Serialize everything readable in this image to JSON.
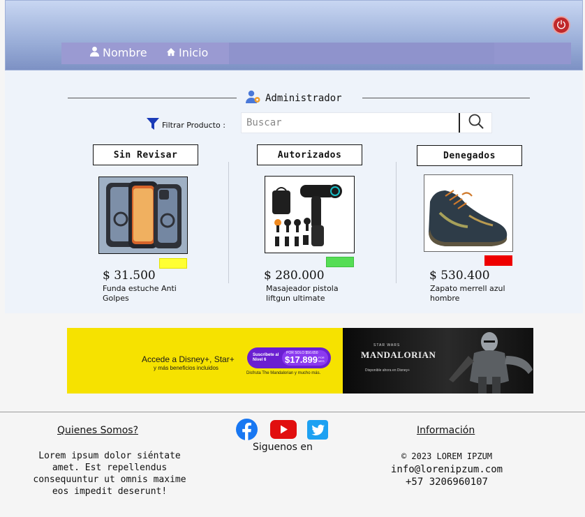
{
  "header": {
    "nav": [
      {
        "label": "Nombre",
        "icon": "user-icon"
      },
      {
        "label": "Inicio",
        "icon": "home-icon"
      }
    ],
    "power_icon": "power-icon"
  },
  "main": {
    "title": "Administrador",
    "filter_label": "Filtrar Producto :",
    "search_placeholder": "Buscar",
    "columns": [
      {
        "title": "Sin Revisar",
        "product": {
          "price": "$ 31.500",
          "name": "Funda estuche Anti Golpes",
          "status_color": "#ffff33"
        }
      },
      {
        "title": "Autorizados",
        "product": {
          "price": "$ 280.000",
          "name": "Masajeador pistola liftgun ultimate",
          "status_color": "#55dd55"
        }
      },
      {
        "title": "Denegados",
        "product": {
          "price": "$ 530.400",
          "name": "Zapato merrell azul hombre",
          "status_color": "#ee0000"
        }
      }
    ]
  },
  "banner": {
    "headline": "Accede a Disney+, Star+",
    "subline": "y más beneficios incluidos",
    "promo_top": "Suscríbete al Nivel 6",
    "promo_old": "POR SOLO $50.650",
    "promo_price": "$17.899",
    "promo_unit": "POR MES",
    "tagline": "Disfruta The Mandalorian y mucho más.",
    "brand": "STAR WARS",
    "show": "MANDALORIAN",
    "available": "Disponible ahora en Disney+"
  },
  "footer": {
    "about_title": "Quienes Somos?",
    "about_text": "Lorem ipsum dolor siéntate amet. Est repellendus consequuntur ut omnis maxime eos impedit deserunt!",
    "social_label": "Siguenos en",
    "info_title": "Información",
    "copyright": "© 2023 LOREM IPZUM",
    "email": "info@lorenipzum.com",
    "phone": "+57 3206960107"
  }
}
